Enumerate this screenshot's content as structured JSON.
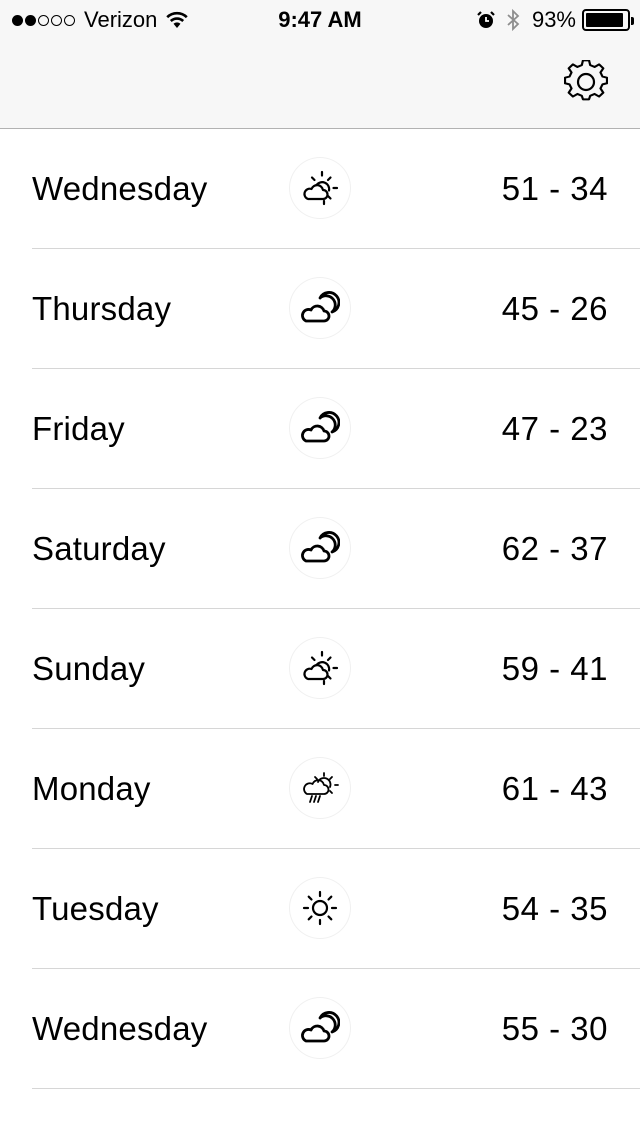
{
  "status_bar": {
    "carrier": "Verizon",
    "signal_bars_filled": 2,
    "signal_bars_total": 5,
    "time": "9:47 AM",
    "battery_percent": "93%",
    "battery_level": 0.93,
    "icons": [
      "wifi-icon",
      "alarm-icon",
      "bluetooth-icon",
      "battery-icon"
    ]
  },
  "header": {
    "settings_icon": "gear-icon"
  },
  "forecast": [
    {
      "day": "Wednesday",
      "icon": "partly-sunny-icon",
      "temps": "51 - 34"
    },
    {
      "day": "Thursday",
      "icon": "moon-cloud-icon",
      "temps": "45 - 26"
    },
    {
      "day": "Friday",
      "icon": "moon-cloud-icon",
      "temps": "47 - 23"
    },
    {
      "day": "Saturday",
      "icon": "moon-cloud-icon",
      "temps": "62 - 37"
    },
    {
      "day": "Sunday",
      "icon": "partly-sunny-icon",
      "temps": "59 - 41"
    },
    {
      "day": "Monday",
      "icon": "sun-rain-cloud-icon",
      "temps": "61 - 43"
    },
    {
      "day": "Tuesday",
      "icon": "sun-icon",
      "temps": "54 - 35"
    },
    {
      "day": "Wednesday",
      "icon": "moon-cloud-icon",
      "temps": "55 - 30"
    }
  ]
}
